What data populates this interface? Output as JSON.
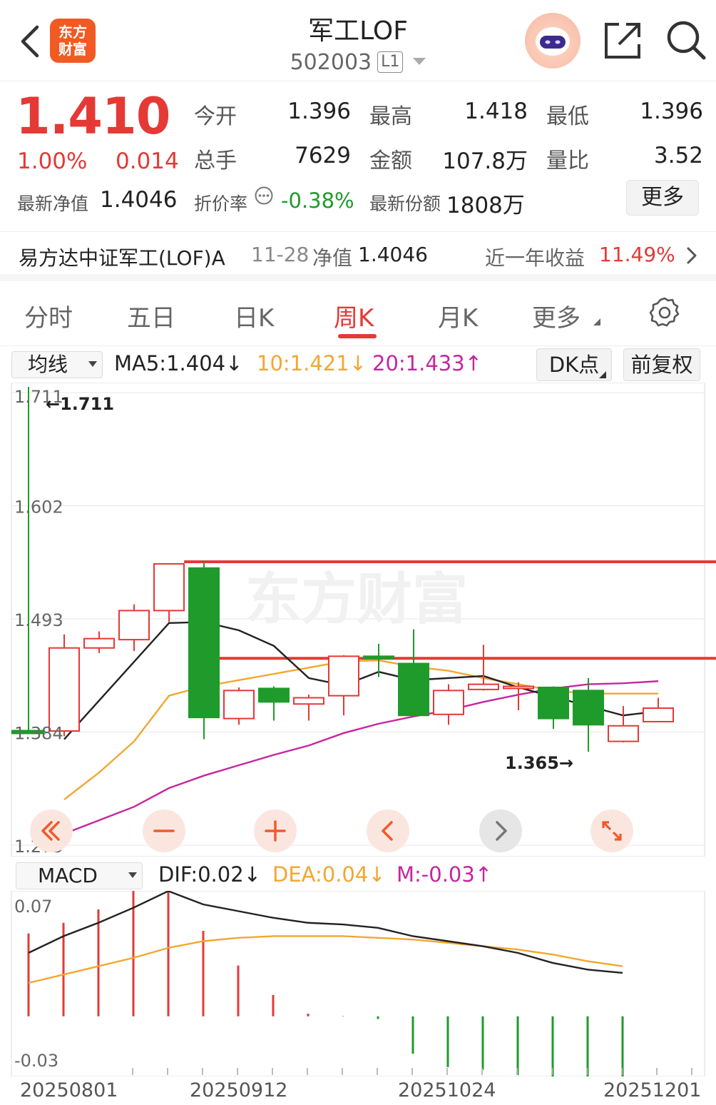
{
  "header": {
    "title": "军工LOF",
    "code": "502003",
    "level_badge": "L1",
    "logo_line1": "东方",
    "logo_line2": "财富"
  },
  "quote": {
    "price": "1.410",
    "change_pct": "1.00%",
    "change": "0.014",
    "fields": [
      {
        "label": "今开",
        "value": "1.396",
        "color": "#222222"
      },
      {
        "label": "最高",
        "value": "1.418",
        "color": "#e53935"
      },
      {
        "label": "最低",
        "value": "1.396",
        "color": "#222222"
      },
      {
        "label": "总手",
        "value": "7629",
        "color": "#222222"
      },
      {
        "label": "金额",
        "value": "107.8万",
        "color": "#222222"
      },
      {
        "label": "量比",
        "value": "3.52",
        "color": "#222222"
      }
    ],
    "nav_label": "最新净值",
    "nav_value": "1.4046",
    "discount_label": "折价率",
    "discount_value": "-0.38%",
    "shares_label": "最新份额",
    "shares_value": "1808万",
    "more_label": "更多"
  },
  "fund": {
    "name": "易方达中证军工(LOF)A",
    "date": "11-28",
    "nav_label": "净值",
    "nav": "1.4046",
    "yield_label": "近一年收益",
    "yield_value": "11.49%"
  },
  "tabs": [
    {
      "label": "分时",
      "active": false
    },
    {
      "label": "五日",
      "active": false
    },
    {
      "label": "日K",
      "active": false
    },
    {
      "label": "周K",
      "active": true
    },
    {
      "label": "月K",
      "active": false
    },
    {
      "label": "更多",
      "active": false
    }
  ],
  "ma_row": {
    "select_label": "均线",
    "ma5": "MA5:1.404↓",
    "ma10": "10:1.421↓",
    "ma20": "20:1.433↑",
    "dk_label": "DK点",
    "adjust_label": "前复权"
  },
  "macd_row": {
    "select_label": "MACD",
    "dif": "DIF:0.02↓",
    "dea": "DEA:0.04↓",
    "m": "M:-0.03↑"
  },
  "colors": {
    "up": "#e53935",
    "down": "#1e9b2a",
    "ma5": "#222222",
    "ma10": "#f2a730",
    "ma20": "#c6269f",
    "accent": "#e53935"
  },
  "chart_data": {
    "type": "candlestick",
    "y_axis_labels": [
      "1.711",
      "1.602",
      "1.493",
      "1.384",
      "1.275"
    ],
    "ylim": [
      1.275,
      1.711
    ],
    "max_annotation": "←1.711",
    "min_annotation": "1.365→",
    "x_labels": [
      "20250801",
      "20250912",
      "20251024",
      "20251201"
    ],
    "watermark": "东方财富",
    "candles": [
      {
        "open": 1.385,
        "close": 1.465,
        "high": 1.478,
        "low": 1.38
      },
      {
        "open": 1.465,
        "close": 1.474,
        "high": 1.481,
        "low": 1.46
      },
      {
        "open": 1.473,
        "close": 1.501,
        "high": 1.507,
        "low": 1.462
      },
      {
        "open": 1.501,
        "close": 1.546,
        "high": 1.546,
        "low": 1.49
      },
      {
        "open": 1.542,
        "close": 1.398,
        "high": 1.549,
        "low": 1.377
      },
      {
        "open": 1.397,
        "close": 1.424,
        "high": 1.427,
        "low": 1.391
      },
      {
        "open": 1.426,
        "close": 1.413,
        "high": 1.428,
        "low": 1.395
      },
      {
        "open": 1.411,
        "close": 1.417,
        "high": 1.42,
        "low": 1.395
      },
      {
        "open": 1.419,
        "close": 1.457,
        "high": 1.458,
        "low": 1.4
      },
      {
        "open": 1.457,
        "close": 1.455,
        "high": 1.469,
        "low": 1.437
      },
      {
        "open": 1.45,
        "close": 1.4,
        "high": 1.483,
        "low": 1.4
      },
      {
        "open": 1.401,
        "close": 1.424,
        "high": 1.43,
        "low": 1.391
      },
      {
        "open": 1.425,
        "close": 1.43,
        "high": 1.468,
        "low": 1.424
      },
      {
        "open": 1.428,
        "close": 1.428,
        "high": 1.432,
        "low": 1.405
      },
      {
        "open": 1.427,
        "close": 1.397,
        "high": 1.428,
        "low": 1.387
      },
      {
        "open": 1.424,
        "close": 1.391,
        "high": 1.436,
        "low": 1.365
      },
      {
        "open": 1.375,
        "close": 1.39,
        "high": 1.409,
        "low": 1.374
      },
      {
        "open": 1.394,
        "close": 1.407,
        "high": 1.417,
        "low": 1.394
      }
    ],
    "ma5": [
      1.377,
      null,
      null,
      1.489,
      1.49,
      1.482,
      1.467,
      1.436,
      1.429,
      1.442,
      1.434,
      1.436,
      1.438,
      1.427,
      1.418,
      1.409,
      1.4,
      1.404
    ],
    "ma10": [
      1.319,
      1.345,
      1.375,
      1.419,
      1.428,
      1.434,
      1.44,
      1.446,
      1.452,
      1.453,
      1.447,
      1.443,
      1.436,
      1.43,
      1.424,
      1.421,
      1.421,
      1.421
    ],
    "ma20": [
      1.286,
      1.299,
      1.312,
      1.33,
      1.342,
      1.352,
      1.362,
      1.371,
      1.383,
      1.392,
      1.399,
      1.405,
      1.413,
      1.42,
      1.426,
      1.43,
      1.431,
      1.433
    ],
    "trend_lines": [
      {
        "y": 1.548,
        "from_index": 3.8
      },
      {
        "y": 1.455,
        "from_index": 4.0
      }
    ]
  },
  "macd_data": {
    "y_axis_labels": [
      "0.07",
      "-0.03"
    ],
    "ylim": [
      -0.03,
      0.07
    ],
    "dif": [
      0.038,
      0.048,
      0.056,
      0.065,
      0.075,
      0.067,
      0.063,
      0.059,
      0.056,
      0.055,
      0.053,
      0.048,
      0.045,
      0.042,
      0.038,
      0.032,
      0.028,
      0.026
    ],
    "dea": [
      0.02,
      0.025,
      0.03,
      0.035,
      0.041,
      0.045,
      0.047,
      0.048,
      0.048,
      0.048,
      0.047,
      0.046,
      0.044,
      0.042,
      0.04,
      0.037,
      0.033,
      0.03
    ],
    "m": [
      0.031,
      0.035,
      0.04,
      0.047,
      0.052,
      0.032,
      0.019,
      0.008,
      0.001,
      0.0,
      -0.001,
      -0.014,
      -0.019,
      -0.02,
      -0.022,
      -0.028,
      -0.03,
      -0.03
    ]
  },
  "controls": [
    "fast-back",
    "zoom-out",
    "zoom-in",
    "prev",
    "next",
    "fullscreen"
  ]
}
